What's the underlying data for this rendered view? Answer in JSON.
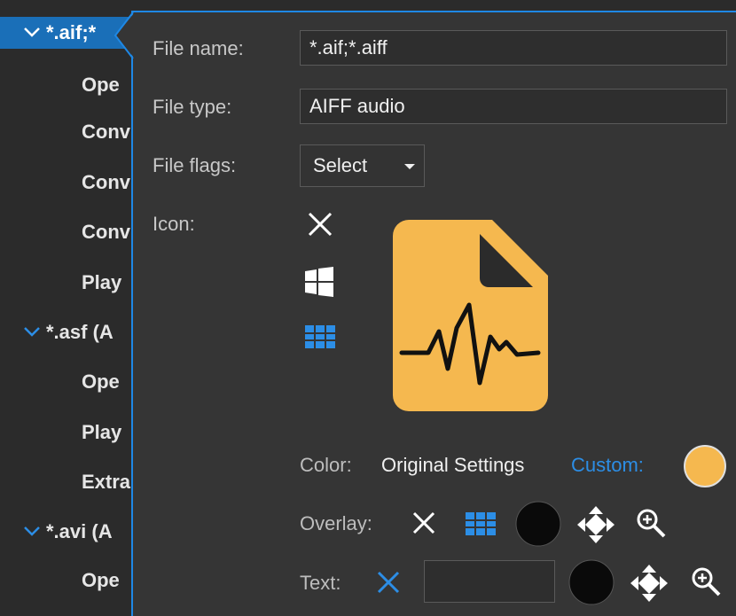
{
  "tree": {
    "items": [
      {
        "type": "group",
        "label": "*.aif;*",
        "selected": true
      },
      {
        "type": "child",
        "label": "Ope"
      },
      {
        "type": "child",
        "label": "Conv"
      },
      {
        "type": "child",
        "label": "Conv"
      },
      {
        "type": "child",
        "label": "Conv"
      },
      {
        "type": "child",
        "label": "Play"
      },
      {
        "type": "group",
        "label": "*.asf (A"
      },
      {
        "type": "child",
        "label": "Ope"
      },
      {
        "type": "child",
        "label": "Play"
      },
      {
        "type": "child",
        "label": "Extra"
      },
      {
        "type": "group",
        "label": "*.avi (A"
      },
      {
        "type": "child",
        "label": "Ope"
      }
    ]
  },
  "form": {
    "file_name_label": "File name:",
    "file_name_value": "*.aif;*.aiff",
    "file_type_label": "File type:",
    "file_type_value": "AIFF audio",
    "file_flags_label": "File flags:",
    "file_flags_value": "Select",
    "icon_label": "Icon:"
  },
  "color_row": {
    "label": "Color:",
    "original": "Original Settings",
    "custom": "Custom:",
    "swatch_color": "#f5b84f"
  },
  "overlay_row": {
    "label": "Overlay:"
  },
  "text_row": {
    "label": "Text:",
    "text_value": ""
  },
  "colors": {
    "accent": "#1e88e5",
    "file_icon": "#f5b84f",
    "selected_row": "#1a6fb8"
  }
}
